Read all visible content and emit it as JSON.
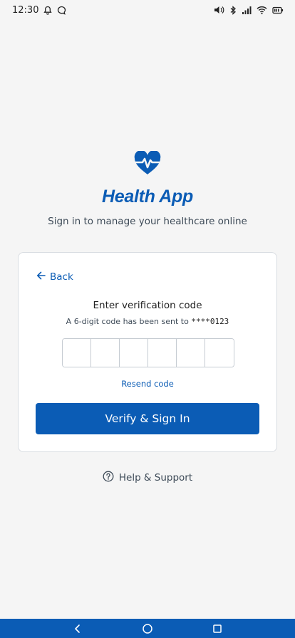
{
  "status_bar": {
    "time": "12:30",
    "left_icons": [
      "bell-icon",
      "chat-bubble-icon"
    ],
    "right_icons": [
      "volume-icon",
      "bluetooth-icon",
      "signal-icon",
      "wifi-icon",
      "battery-icon"
    ]
  },
  "header": {
    "logo_icon": "heart-pulse-icon",
    "app_name": "Health App",
    "subtitle": "Sign in to manage your healthcare online"
  },
  "card": {
    "back_label": "Back",
    "heading": "Enter verification code",
    "info_text": "A 6-digit code has been sent to",
    "masked_number": "****0123",
    "code_length": 6,
    "resend_label": "Resend code",
    "verify_label": "Verify & Sign In"
  },
  "help": {
    "icon": "help-circle-icon",
    "label": "Help & Support"
  },
  "nav_bar": {
    "buttons": [
      "back-nav-icon",
      "home-nav-icon",
      "recents-nav-icon"
    ]
  },
  "colors": {
    "brand": "#0b5cb5",
    "background": "#f5f5f5",
    "card": "#ffffff"
  }
}
